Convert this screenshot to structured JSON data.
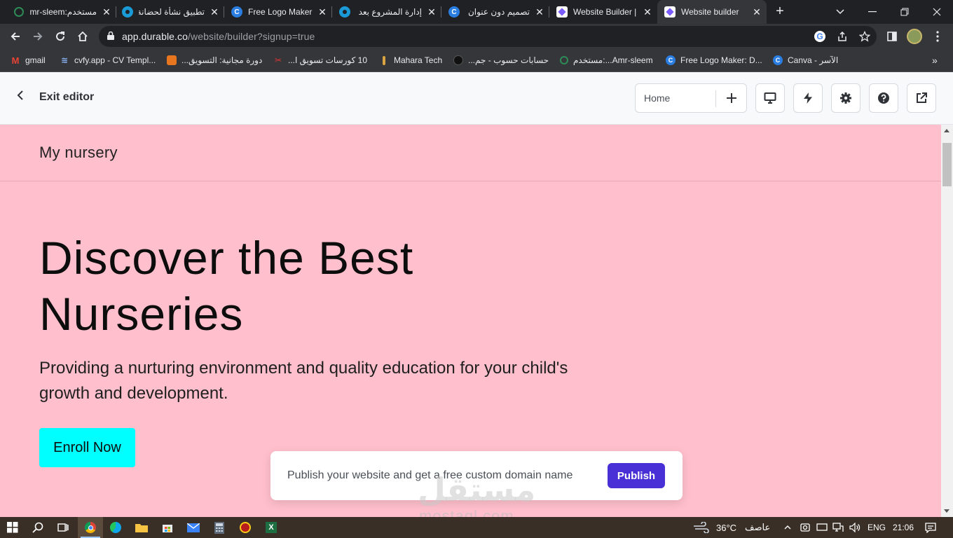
{
  "browser": {
    "tabs": [
      {
        "title": "مستخدم:mr-sleem",
        "favicon": "green-swirl-icon",
        "color": "#2e8b57"
      },
      {
        "title": "تطبيق نشأة لحضانة",
        "favicon": "blue-circle-icon",
        "color": "#1a9bd7"
      },
      {
        "title": "Free Logo Maker",
        "favicon": "canva-icon",
        "color": "#2a7de1"
      },
      {
        "title": "إدارة المشروع بعد",
        "favicon": "blue-circle-icon",
        "color": "#1a9bd7"
      },
      {
        "title": "تصميم دون عنوان",
        "favicon": "canva-icon",
        "color": "#2a7de1"
      },
      {
        "title": "Website Builder |",
        "favicon": "durable-icon",
        "color": "#7b5cff"
      },
      {
        "title": "Website builder",
        "favicon": "durable-icon",
        "color": "#7b5cff",
        "active": true
      }
    ],
    "url_host": "app.durable.co",
    "url_path": "/website/builder?signup=true",
    "bookmarks": [
      {
        "label": "gmail",
        "favicon": "gmail-icon"
      },
      {
        "label": "cvfy.app - CV Templ...",
        "favicon": "layers-icon"
      },
      {
        "label": "دورة مجانية: التسويق...",
        "favicon": "orange-square-icon"
      },
      {
        "label": "10 كورسات تسويق ا...",
        "favicon": "red-bookmark-icon"
      },
      {
        "label": "Mahara Tech",
        "favicon": "bottle-icon"
      },
      {
        "label": "حسابات حسوب - جم...",
        "favicon": "dark-circle-icon"
      },
      {
        "label": "مستخدم:...Amr-sleem",
        "favicon": "green-swirl-icon"
      },
      {
        "label": "Free Logo Maker: D...",
        "favicon": "canva-icon"
      },
      {
        "label": "Canva - الآسر",
        "favicon": "canva-icon"
      }
    ]
  },
  "editor": {
    "exit_label": "Exit editor",
    "page_select": "Home",
    "tools": [
      "desktop-icon",
      "lightning-icon",
      "gear-icon",
      "help-icon",
      "external-link-icon"
    ]
  },
  "site": {
    "name": "My nursery",
    "hero_title": "Discover the Best Nurseries",
    "hero_subtitle": "Providing a nurturing environment and quality education for your child's growth and development.",
    "cta_label": "Enroll Now",
    "background_color": "#ffbfcc",
    "cta_color": "#00ffff"
  },
  "toast": {
    "message": "Publish your website and get a free custom domain name",
    "button_label": "Publish",
    "accent": "#4930d6"
  },
  "watermark": {
    "arabic": "مستقل",
    "latin": "mostaql.com"
  },
  "taskbar": {
    "weather_temp": "36°C",
    "weather_text": "عاصف",
    "lang": "ENG",
    "time": "21:06"
  }
}
